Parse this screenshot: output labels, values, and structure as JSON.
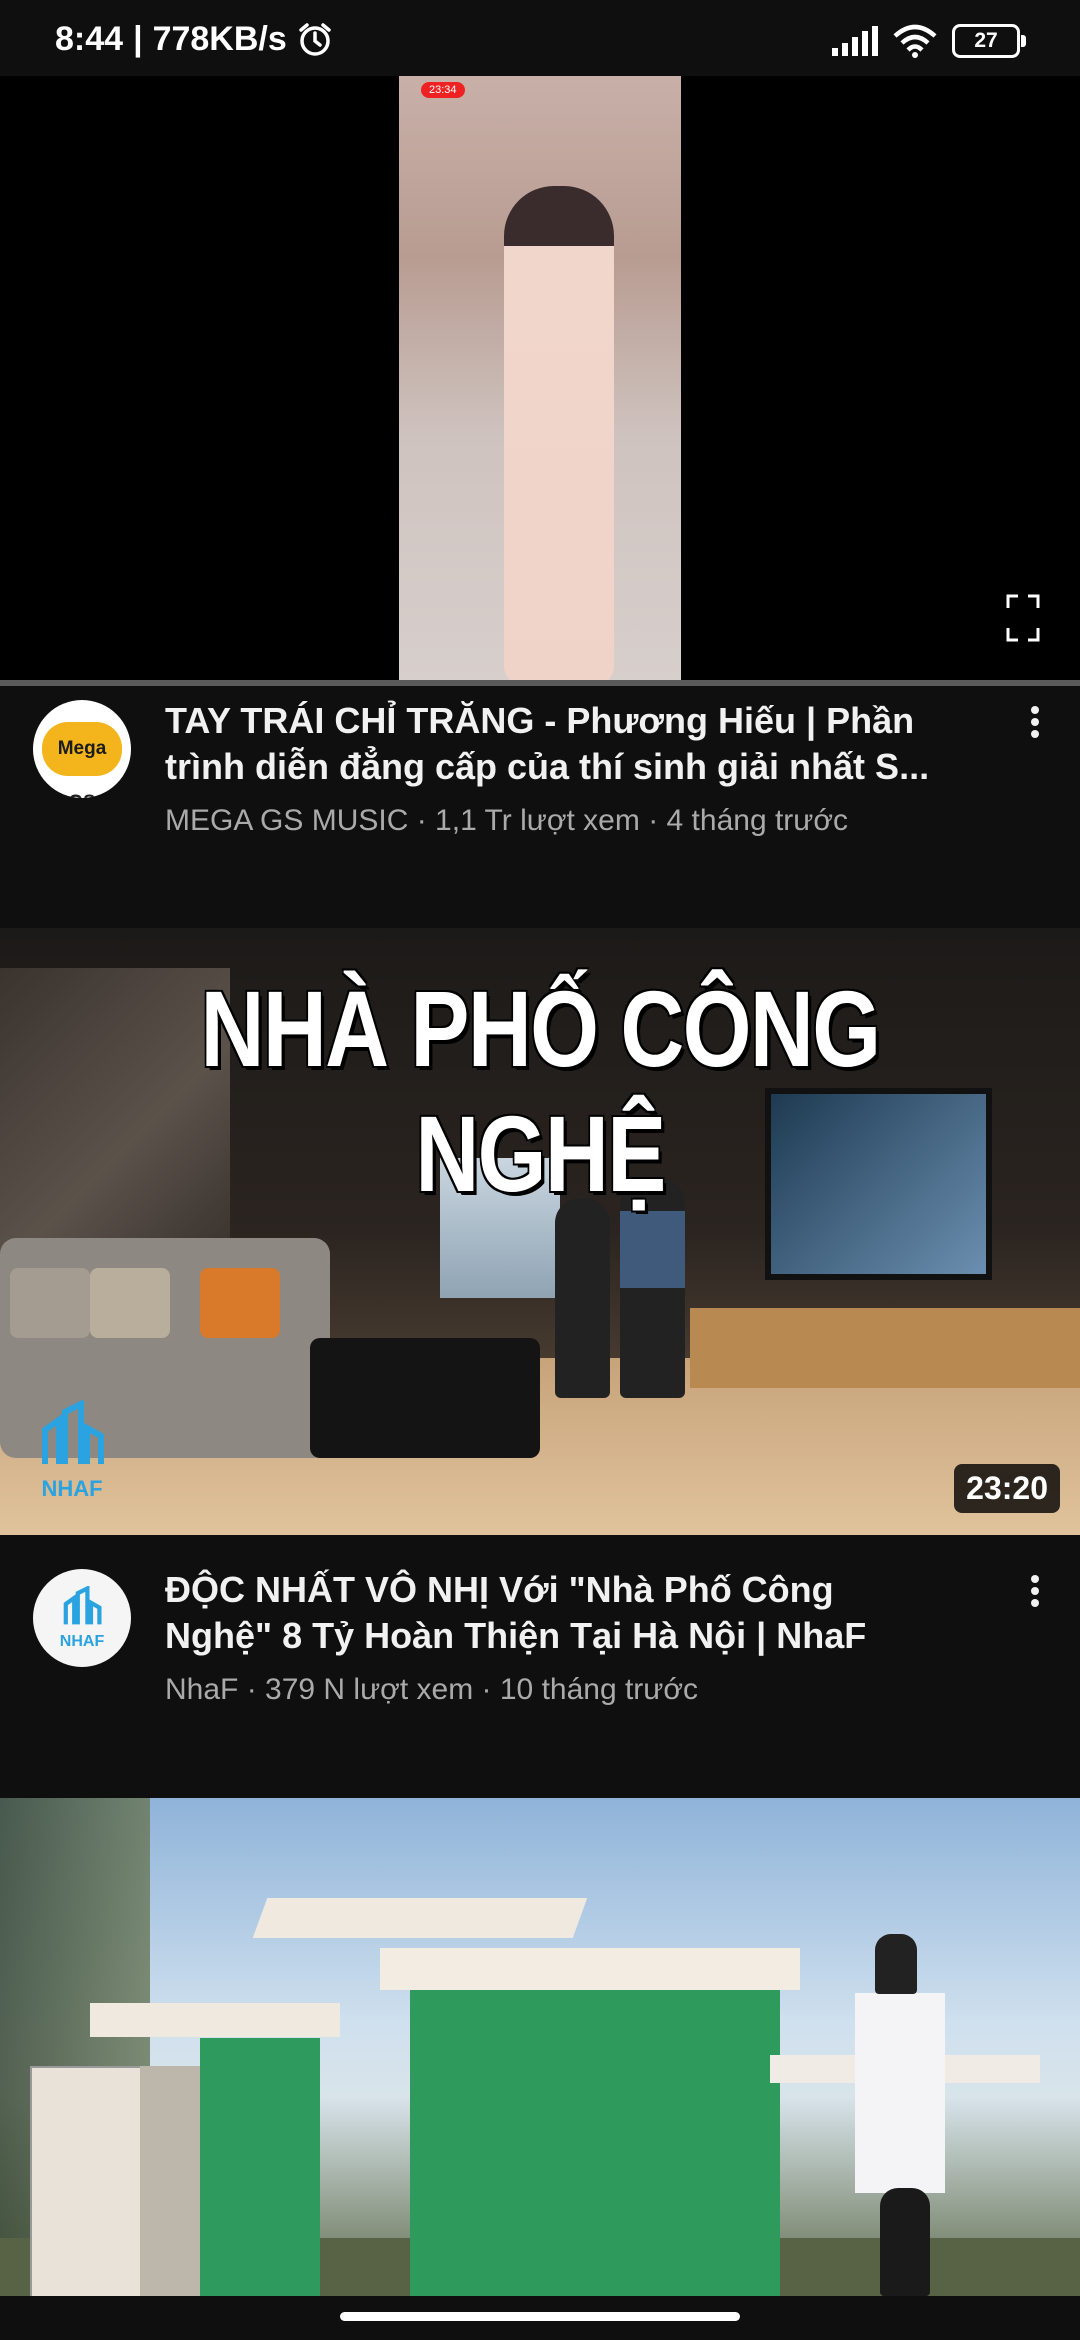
{
  "status_bar": {
    "time": "8:44",
    "separator": "|",
    "speed": "778KB/s",
    "battery": "27"
  },
  "player": {
    "frame_rec_label": "23:34"
  },
  "videos": [
    {
      "title": "TAY TRÁI CHỈ TRĂNG - Phương Hiếu | Phần\ntrình diễn đẳng cấp của thí sinh giải nhất S...",
      "channel": "MEGA GS MUSIC",
      "views": "1,1 Tr lượt xem",
      "age": "4 tháng trước",
      "avatar_text": "Mega GS"
    },
    {
      "thumbnail_headline": "NHÀ PHỐ CÔNG NGHỆ",
      "thumbnail_watermark": "NHAF",
      "duration": "23:20",
      "title": "ĐỘC NHẤT VÔ NHỊ Với \"Nhà Phố Công\nNghệ\" 8 Tỷ Hoàn Thiện Tại Hà Nội | NhaF",
      "channel": "NhaF",
      "views": "379 N lượt xem",
      "age": "10 tháng trước",
      "avatar_text": "NHAF"
    }
  ],
  "colors": {
    "background": "#0f0f0f",
    "secondary_text": "#aaaaaa",
    "watermark": "#2aa3e0"
  }
}
